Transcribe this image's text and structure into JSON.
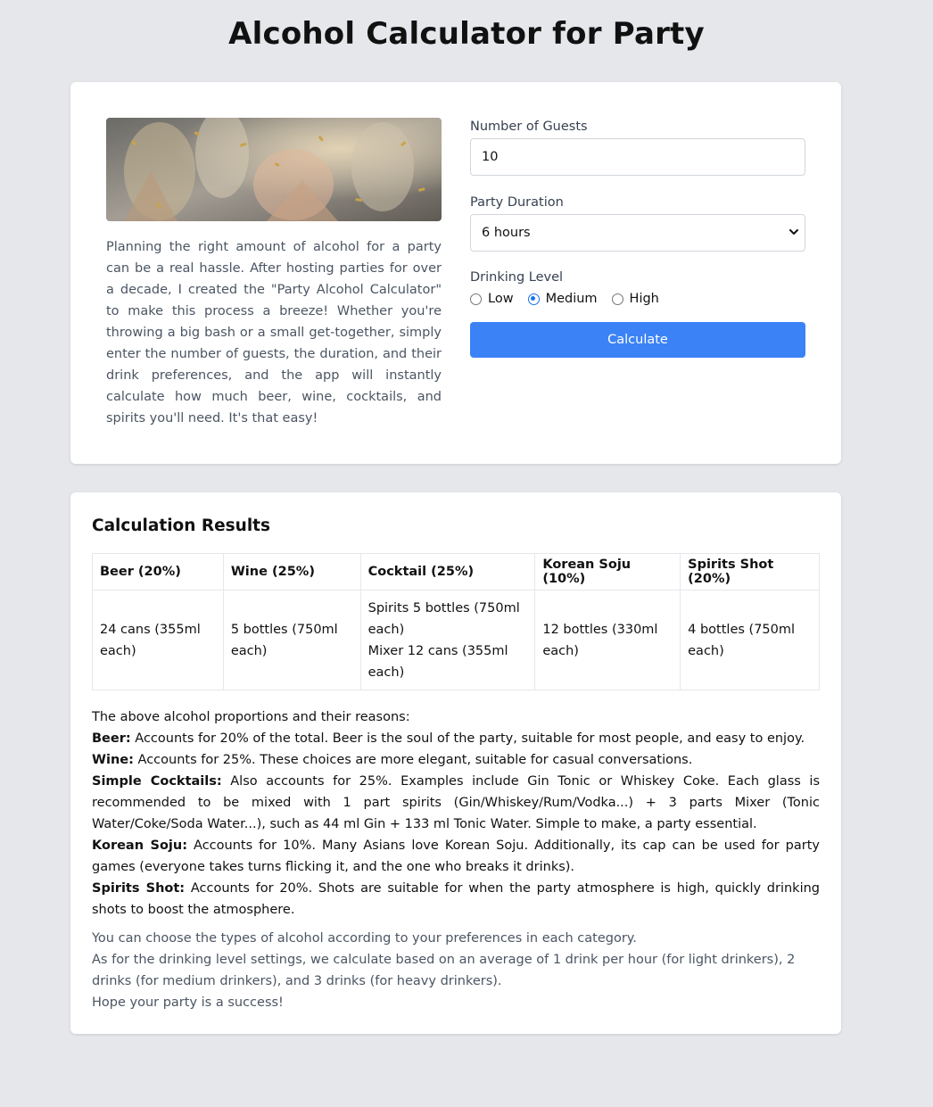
{
  "title": "Alcohol Calculator for Party",
  "intro": "Planning the right amount of alcohol for a party can be a real hassle. After hosting parties for over a decade, I created the \"Party Alcohol Calculator\" to make this process a breeze! Whether you're throwing a big bash or a small get-together, simply enter the number of guests, the duration, and their drink preferences, and the app will instantly calculate how much beer, wine, cocktails, and spirits you'll need. It's that easy!",
  "form": {
    "guests_label": "Number of Guests",
    "guests_value": "10",
    "duration_label": "Party Duration",
    "duration_value": "6 hours",
    "drinking_label": "Drinking Level",
    "levels": [
      "Low",
      "Medium",
      "High"
    ],
    "selected_level": "Medium",
    "calculate_label": "Calculate"
  },
  "results": {
    "title": "Calculation Results",
    "headers": [
      "Beer (20%)",
      "Wine (25%)",
      "Cocktail (25%)",
      "Korean Soju (10%)",
      "Spirits Shot (20%)"
    ],
    "cells": {
      "beer": "24 cans (355ml each)",
      "wine": "5 bottles (750ml each)",
      "cocktail_spirits": "Spirits 5 bottles (750ml each)",
      "cocktail_mixer": "Mixer 12 cans (355ml each)",
      "soju": "12 bottles (330ml each)",
      "shot": "4 bottles (750ml each)"
    },
    "intro": "The above alcohol proportions and their reasons:",
    "reasons": [
      {
        "label": "Beer:",
        "text": " Accounts for 20% of the total. Beer is the soul of the party, suitable for most people, and easy to enjoy."
      },
      {
        "label": "Wine:",
        "text": " Accounts for 25%. These choices are more elegant, suitable for casual conversations."
      },
      {
        "label": "Simple Cocktails:",
        "text": " Also accounts for 25%. Examples include Gin Tonic or Whiskey Coke. Each glass is recommended to be mixed with 1 part spirits (Gin/Whiskey/Rum/Vodka...) + 3 parts Mixer (Tonic Water/Coke/Soda Water...), such as 44 ml Gin + 133 ml Tonic Water. Simple to make, a party essential."
      },
      {
        "label": "Korean Soju:",
        "text": " Accounts for 10%. Many Asians love Korean Soju. Additionally, its cap can be used for party games (everyone takes turns flicking it, and the one who breaks it drinks)."
      },
      {
        "label": "Spirits Shot:",
        "text": " Accounts for 20%. Shots are suitable for when the party atmosphere is high, quickly drinking shots to boost the atmosphere."
      }
    ],
    "notes": [
      "You can choose the types of alcohol according to your preferences in each category.",
      "As for the drinking level settings, we calculate based on an average of 1 drink per hour (for light drinkers), 2 drinks (for medium drinkers), and 3 drinks (for heavy drinkers).",
      "Hope your party is a success!"
    ]
  },
  "colors": {
    "page_bg": "#e5e7eb",
    "card_bg": "#ffffff",
    "accent": "#3b82f6",
    "muted_text": "#4b5563"
  },
  "icons": {
    "select_arrow": "chevron-down-icon",
    "hero": "party-toast-photo"
  }
}
